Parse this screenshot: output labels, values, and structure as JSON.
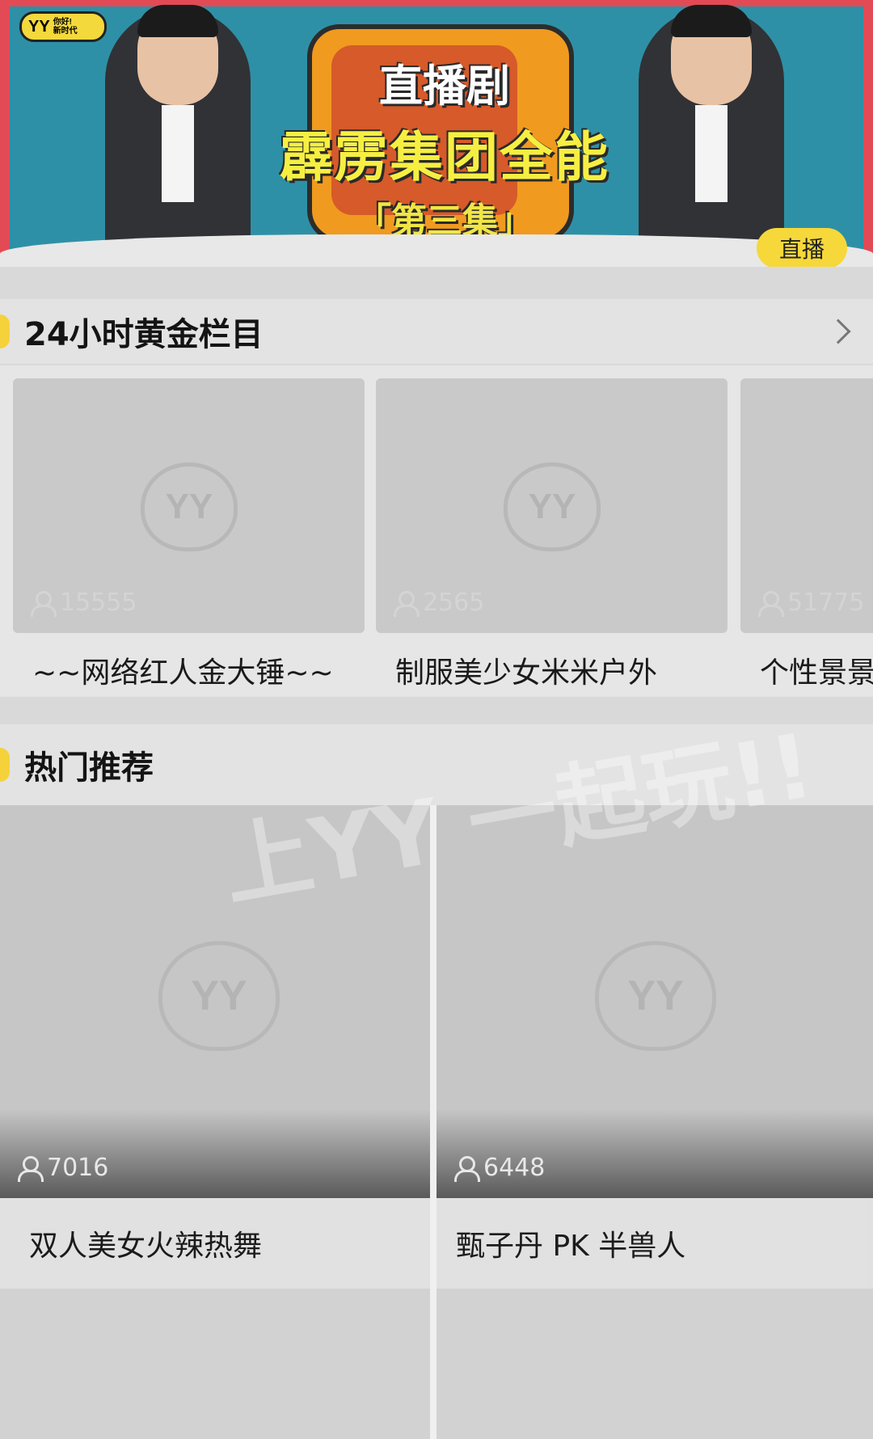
{
  "banner": {
    "logo_main": "YY",
    "logo_sub1": "你好!",
    "logo_sub2": "新时代",
    "title_line1": "直播剧",
    "title_line2": "霹雳集团全能",
    "title_line3": "「第三集」",
    "badge": "直播",
    "colors": {
      "frame": "#e24a55",
      "sky": "#2e90a6",
      "tv": "#f09a1f",
      "accent": "#f6ef42"
    }
  },
  "golden_section": {
    "title": "24小时黄金栏目",
    "more_icon": "chevron-right-icon",
    "cards": [
      {
        "caption": "~~网络红人金大锤~~",
        "viewers": "15555"
      },
      {
        "caption": "制服美少女米米户外",
        "viewers": "2565"
      },
      {
        "caption": "个性景景",
        "viewers": "51775"
      }
    ]
  },
  "hot_section": {
    "title": "热门推荐",
    "cards": [
      {
        "caption": "双人美女火辣热舞",
        "viewers": "7016"
      },
      {
        "caption": "甄子丹 PK 半兽人",
        "viewers": "6448"
      }
    ]
  },
  "overlay": {
    "text": "上YY 一起玩!!"
  },
  "watermark": "YY"
}
